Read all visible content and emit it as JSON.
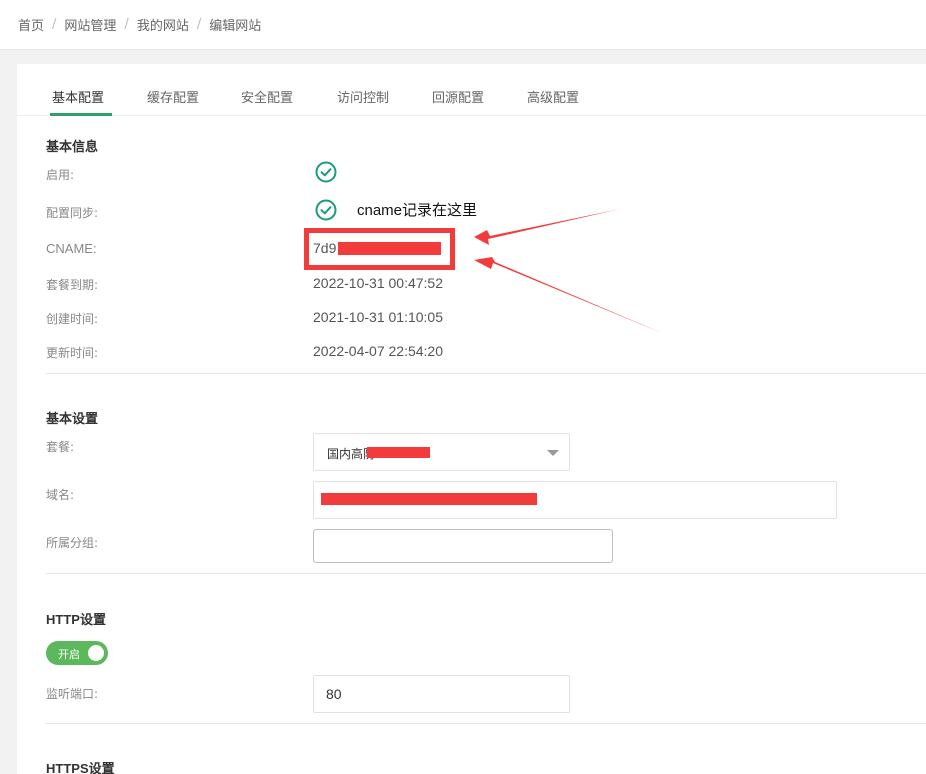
{
  "breadcrumb": [
    "首页",
    "网站管理",
    "我的网站",
    "编辑网站"
  ],
  "breadcrumb_sep": "/",
  "tabs": [
    "基本配置",
    "缓存配置",
    "安全配置",
    "访问控制",
    "回源配置",
    "高级配置"
  ],
  "active_tab": "基本配置",
  "basic_info": {
    "title": "基本信息",
    "enabled_label": "启用:",
    "sync_label": "配置同步:",
    "cname_label": "CNAME:",
    "cname_value": "7d9",
    "expire_label": "套餐到期:",
    "expire_value": "2022-10-31 00:47:52",
    "created_label": "创建时间:",
    "created_value": "2021-10-31 01:10:05",
    "updated_label": "更新时间:",
    "updated_value": "2022-04-07 22:54:20"
  },
  "annotation": {
    "text": "cname记录在这里",
    "color": "#f23c3c"
  },
  "basic_settings": {
    "title": "基本设置",
    "package_label": "套餐:",
    "package_value": "国内高防",
    "domain_label": "域名:",
    "group_label": "所属分组:",
    "group_value": ""
  },
  "http": {
    "title": "HTTP设置",
    "switch_label": "开启",
    "switch_on": true,
    "port_label": "监听端口:",
    "port_value": "80"
  },
  "https": {
    "title": "HTTPS设置"
  },
  "colors": {
    "accent": "#2f9f6b",
    "check": "#1a9a7f",
    "switch": "#5cb85c",
    "redaction": "#f23c3c"
  },
  "icons": {
    "enabled": "check-circle-icon",
    "sync": "check-circle-icon",
    "dropdown": "chevron-down-icon"
  }
}
